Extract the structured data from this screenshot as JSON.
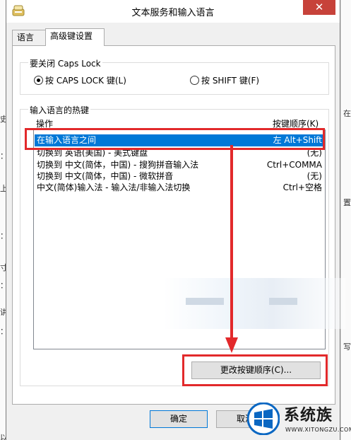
{
  "window": {
    "title": "文本服务和输入语言",
    "close_glyph": "✕"
  },
  "tabs": [
    {
      "label": "语言栏",
      "active": false
    },
    {
      "label": "高级键设置",
      "active": true
    }
  ],
  "caps_lock_group": {
    "title": "要关闭 Caps Lock",
    "options": [
      {
        "label": "按 CAPS LOCK 键(L)",
        "checked": true
      },
      {
        "label": "按 SHIFT 键(F)",
        "checked": false
      }
    ]
  },
  "hotkeys_group": {
    "title": "输入语言的热键",
    "header_action": "操作",
    "header_sequence": "按键顺序(K)",
    "rows": [
      {
        "action": "在输入语言之间",
        "keys": "左 Alt+Shift",
        "selected": true
      },
      {
        "action": "切换到 英语(美国) - 美式键盘",
        "keys": "(无)",
        "selected": false
      },
      {
        "action": "切换到 中文(简体，中国) - 搜狗拼音输入法",
        "keys": "Ctrl+COMMA",
        "selected": false
      },
      {
        "action": "切换到 中文(简体，中国) - 微软拼音",
        "keys": "(无)",
        "selected": false
      },
      {
        "action": "中文(简体)输入法 - 输入法/非输入法切换",
        "keys": "Ctrl+空格",
        "selected": false
      }
    ],
    "change_button": "更改按键顺序(C)..."
  },
  "footer": {
    "ok_button": "确定",
    "cancel_button": "取消"
  },
  "background_fragments": {
    "left": [
      "史",
      "：",
      "上",
      "：",
      "寸",
      "：",
      "讲",
      "：",
      "以"
    ],
    "right": [
      "在",
      "置",
      "写"
    ]
  },
  "watermark": {
    "brand": "系统族",
    "url": "WWW.XITONGZU.COM"
  },
  "colors": {
    "selection": "#0078d7",
    "annotation": "#e2292b",
    "close": "#c7423a"
  }
}
